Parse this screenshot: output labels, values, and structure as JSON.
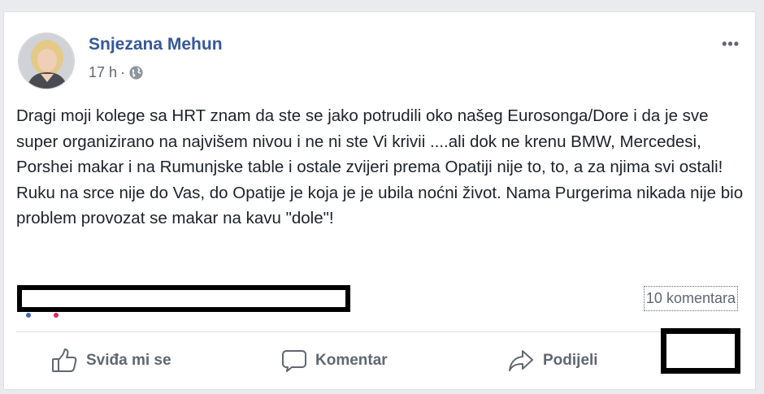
{
  "post": {
    "author": "Snjezana Mehun",
    "time": "17 h",
    "separator": "·",
    "privacy_icon": "globe-icon",
    "more_icon": "more-options-icon",
    "more_label": "•••",
    "text": "Dragi moji kolege sa HRT znam da ste se jako potrudili oko našeg Eurosonga/Dore i da je sve super organizirano na najvišem nivou i ne ni ste Vi krivii ....ali dok ne krenu BMW, Mercedesi, Porshei makar i na Rumunjske table i ostale zvijeri prema Opatiji nije to, to, a za njima svi ostali! Ruku na srce nije do Vas, do Opatije je koja je je ubila noćni život. Nama Purgerima nikada nije bio problem provozat se makar na kavu \"dole\"!"
  },
  "footer": {
    "comments_count": "10 komentara"
  },
  "actions": {
    "like": {
      "label": "Sviđa mi se",
      "icon": "thumbs-up-icon"
    },
    "comment": {
      "label": "Komentar",
      "icon": "comment-bubble-icon"
    },
    "share": {
      "label": "Podijeli",
      "icon": "share-arrow-icon"
    }
  },
  "colors": {
    "author_link": "#365899",
    "secondary_text": "#606770",
    "body_text": "#1d2129",
    "background": "#e9ebee"
  }
}
